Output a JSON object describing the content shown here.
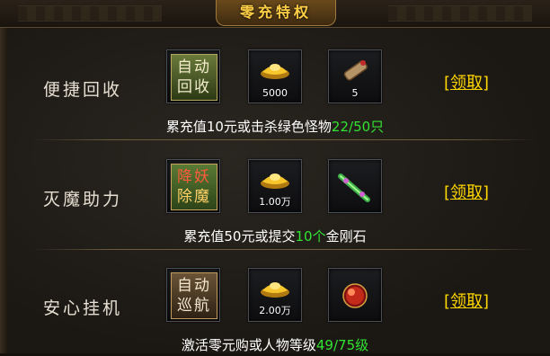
{
  "header": {
    "title": "零充特权"
  },
  "rows": [
    {
      "title": "便捷回收",
      "badge": {
        "line1": "自动",
        "line2": "回收",
        "style": "green"
      },
      "rewards": [
        {
          "icon": "gold-ingot-icon",
          "qty": "5000"
        },
        {
          "icon": "scroll-icon",
          "qty": "5"
        }
      ],
      "claim_label": "[领取]",
      "desc": {
        "prefix": "累充值10元或击杀绿色怪物",
        "highlight": "22/50只",
        "suffix": ""
      }
    },
    {
      "title": "灭魔助力",
      "badge": {
        "line1": "降妖",
        "line2": "除魔",
        "style": "red"
      },
      "rewards": [
        {
          "icon": "gold-ingot-icon",
          "qty": "1.00万"
        },
        {
          "icon": "green-sword-icon",
          "qty": ""
        }
      ],
      "claim_label": "[领取]",
      "desc": {
        "prefix": "累充值50元或提交",
        "highlight": "10个",
        "suffix": "金刚石"
      }
    },
    {
      "title": "安心挂机",
      "badge": {
        "line1": "自动",
        "line2": "巡航",
        "style": "brown"
      },
      "rewards": [
        {
          "icon": "gold-ingot-icon",
          "qty": "2.00万"
        },
        {
          "icon": "red-orb-icon",
          "qty": ""
        }
      ],
      "claim_label": "[领取]",
      "desc": {
        "prefix": "激活零元购或人物等级",
        "highlight": "49/75级",
        "suffix": ""
      }
    }
  ],
  "colors": {
    "accent": "#ffd700",
    "highlight": "#32e332",
    "title": "#ffcf45"
  }
}
